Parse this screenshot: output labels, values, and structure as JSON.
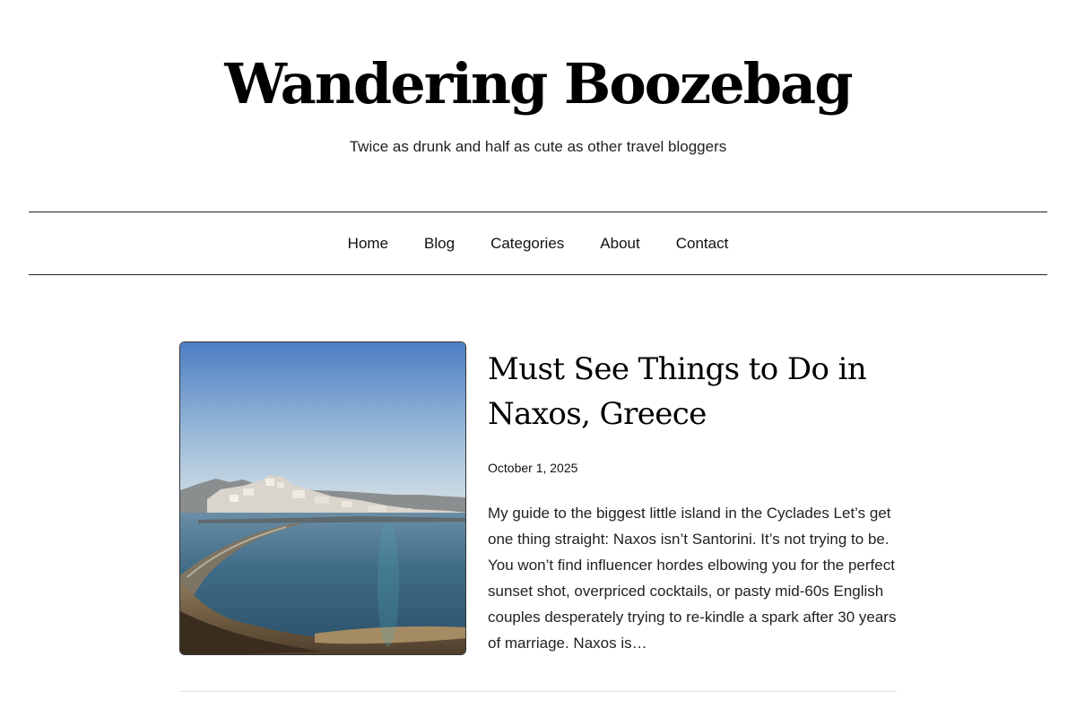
{
  "site": {
    "title": "Wandering Boozebag",
    "tagline": "Twice as drunk and half as cute as other travel bloggers"
  },
  "nav": {
    "items": [
      {
        "label": "Home"
      },
      {
        "label": "Blog"
      },
      {
        "label": "Categories"
      },
      {
        "label": "About"
      },
      {
        "label": "Contact"
      }
    ]
  },
  "post": {
    "title": "Must See Things to Do in Naxos, Greece",
    "date": "October 1, 2025",
    "excerpt": "My guide to the biggest little island in the Cyclades Let’s get one thing straight: Naxos isn’t Santorini. It’s not trying to be. You won’t find influencer hordes elbowing you for the perfect sunset shot, overpriced cocktails, or pasty mid-60s English couples desperately trying to re-kindle a spark after 30 years of marriage. Naxos is…",
    "image_icon": "coastal-town-photo"
  },
  "colors": {
    "text": "#111111",
    "rule": "#222222",
    "divider": "#dddddd",
    "sky_top": "#4f7fc4",
    "sky_bottom": "#c9dbe8",
    "sea": "#2f5f7a"
  }
}
